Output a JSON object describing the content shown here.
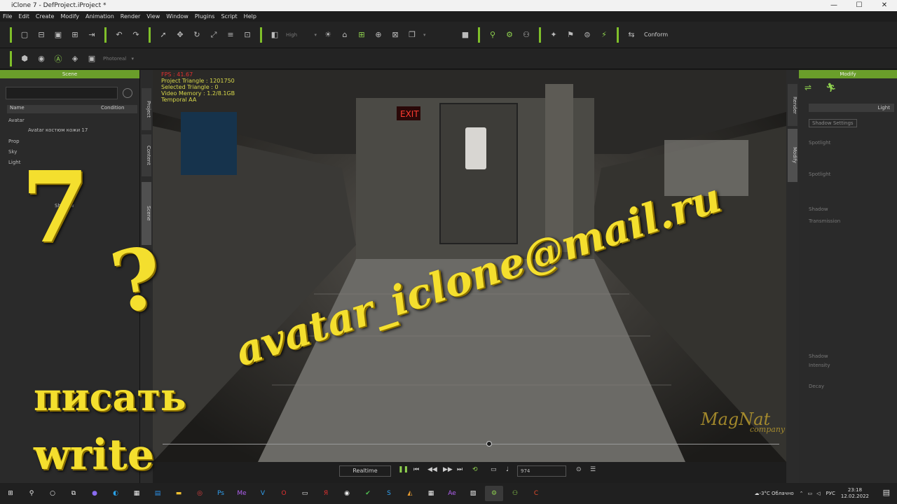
{
  "window": {
    "title": "iClone 7 - DefProject.iProject *"
  },
  "menu": [
    "File",
    "Edit",
    "Create",
    "Modify",
    "Animation",
    "Render",
    "View",
    "Window",
    "Plugins",
    "Script",
    "Help"
  ],
  "toolbar": {
    "quality": "High",
    "conform": "Conform",
    "render_mode": "Photoreal"
  },
  "scene_panel": {
    "title": "Scene",
    "columns": [
      "Name",
      "Condition"
    ],
    "items": [
      "Avatar",
      "Avatar костюм кожи 17",
      "Prop",
      "Sky",
      "Light",
      "Shadow"
    ]
  },
  "left_tabs": [
    "Project",
    "Content",
    "Scene"
  ],
  "right_tabs": [
    "Render",
    "Modify"
  ],
  "modify_panel": {
    "title": "Modify",
    "light_label": "Light",
    "shadow_settings": "Shadow Settings",
    "rows": [
      "Spotlight",
      "Spotlight",
      "Shadow",
      "Transmission",
      "Shadow",
      "Intensity",
      "Decay"
    ]
  },
  "viewport": {
    "hud": [
      "FPS : 41.67",
      "Project Triangle : 1201750",
      "Selected Triangle : 0",
      "Video Memory : 1.2/8.1GB",
      "Temporal AA"
    ]
  },
  "playback": {
    "mode": "Realtime",
    "frame": "974",
    "progress": 0.53
  },
  "taskbar": {
    "weather": "-3°C Облачно",
    "lang": "РУС",
    "time": "23:18",
    "date": "12.02.2022"
  },
  "overlay": {
    "seven": "7",
    "question": "?",
    "pisat": "писать",
    "write": "write",
    "email": "avatar_iclone@mail.ru",
    "watermark": "MagNat",
    "watermark_sub": "company"
  },
  "colors": {
    "accent": "#7fbf2a",
    "overlay_text": "#f4df2e"
  }
}
